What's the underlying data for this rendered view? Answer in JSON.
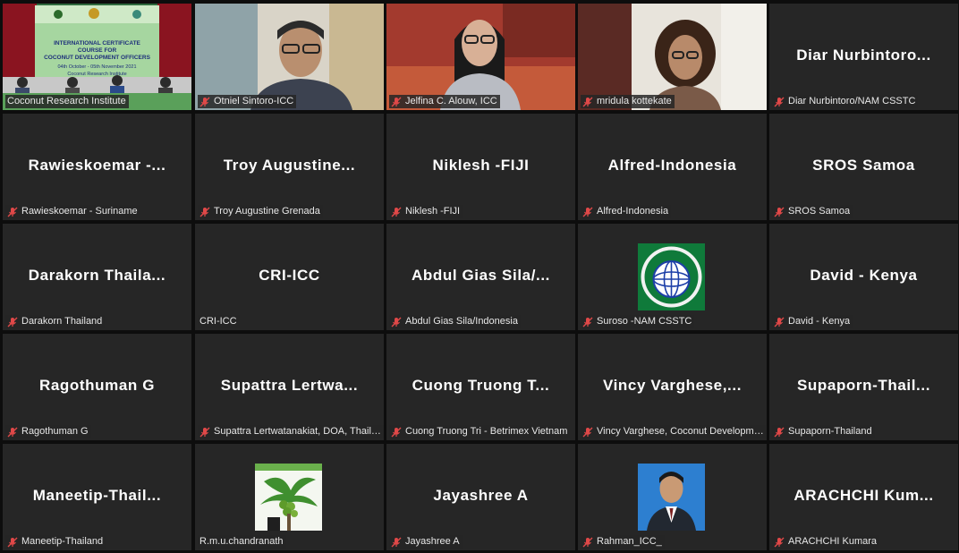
{
  "tiles": [
    {
      "label": "Coconut Research Institute",
      "muted": false,
      "video": "banner",
      "active": true,
      "banner": {
        "title_lines": [
          "INTERNATIONAL CERTIFICATE",
          "COURSE FOR",
          "COCONUT DEVELOPMENT OFFICERS"
        ],
        "dates": "04th October - 05th November 2021",
        "org": "Coconut Research Institute"
      }
    },
    {
      "label": "Otniel Sintoro-ICC",
      "muted": true,
      "video": "man-glasses"
    },
    {
      "label": "Jelfina C. Alouw, ICC",
      "muted": true,
      "video": "woman-blazer"
    },
    {
      "label": "mridula kottekate",
      "muted": true,
      "video": "woman-curly"
    },
    {
      "label": "Diar Nurbintoro/NAM CSSTC",
      "muted": true,
      "name": "Diar Nurbintoro..."
    },
    {
      "label": "Rawieskoemar - Suriname",
      "muted": true,
      "name": "Rawieskoemar -..."
    },
    {
      "label": "Troy Augustine Grenada",
      "muted": true,
      "name": "Troy Augustine..."
    },
    {
      "label": "Niklesh -FIJI",
      "muted": true,
      "name": "Niklesh -FIJI"
    },
    {
      "label": "Alfred-Indonesia",
      "muted": true,
      "name": "Alfred-Indonesia"
    },
    {
      "label": "SROS Samoa",
      "muted": true,
      "name": "SROS Samoa"
    },
    {
      "label": "Darakorn Thailand",
      "muted": true,
      "name": "Darakorn Thaila..."
    },
    {
      "label": "CRI-ICC",
      "muted": false,
      "name": "CRI-ICC"
    },
    {
      "label": "Abdul Gias Sila/Indonesia",
      "muted": true,
      "name": "Abdul Gias Sila/..."
    },
    {
      "label": "Suroso -NAM CSSTC",
      "muted": true,
      "video": "nam-logo"
    },
    {
      "label": "David - Kenya",
      "muted": true,
      "name": "David - Kenya"
    },
    {
      "label": "Ragothuman G",
      "muted": true,
      "name": "Ragothuman G"
    },
    {
      "label": "Supattra Lertwatanakiat, DOA, Thailand",
      "muted": true,
      "name": "Supattra Lertwa..."
    },
    {
      "label": "Cuong Truong Tri - Betrimex Vietnam",
      "muted": true,
      "name": "Cuong Truong T..."
    },
    {
      "label": "Vincy Varghese, Coconut Development Board",
      "muted": true,
      "name": "Vincy Varghese,..."
    },
    {
      "label": "Supaporn-Thailand",
      "muted": true,
      "name": "Supaporn-Thail..."
    },
    {
      "label": "Maneetip-Thailand",
      "muted": true,
      "name": "Maneetip-Thail..."
    },
    {
      "label": "R.m.u.chandranath",
      "muted": false,
      "video": "coconut-photo"
    },
    {
      "label": "Jayashree A",
      "muted": true,
      "name": "Jayashree A"
    },
    {
      "label": "Rahman_ICC_",
      "muted": true,
      "video": "portrait-photo"
    },
    {
      "label": "ARACHCHI Kumara",
      "muted": true,
      "name": "ARACHCHI Kum..."
    }
  ],
  "colors": {
    "tile_bg": "#262626",
    "active_outline": "#e6e34a",
    "mute_icon": "#e04848",
    "text": "#ffffff"
  }
}
